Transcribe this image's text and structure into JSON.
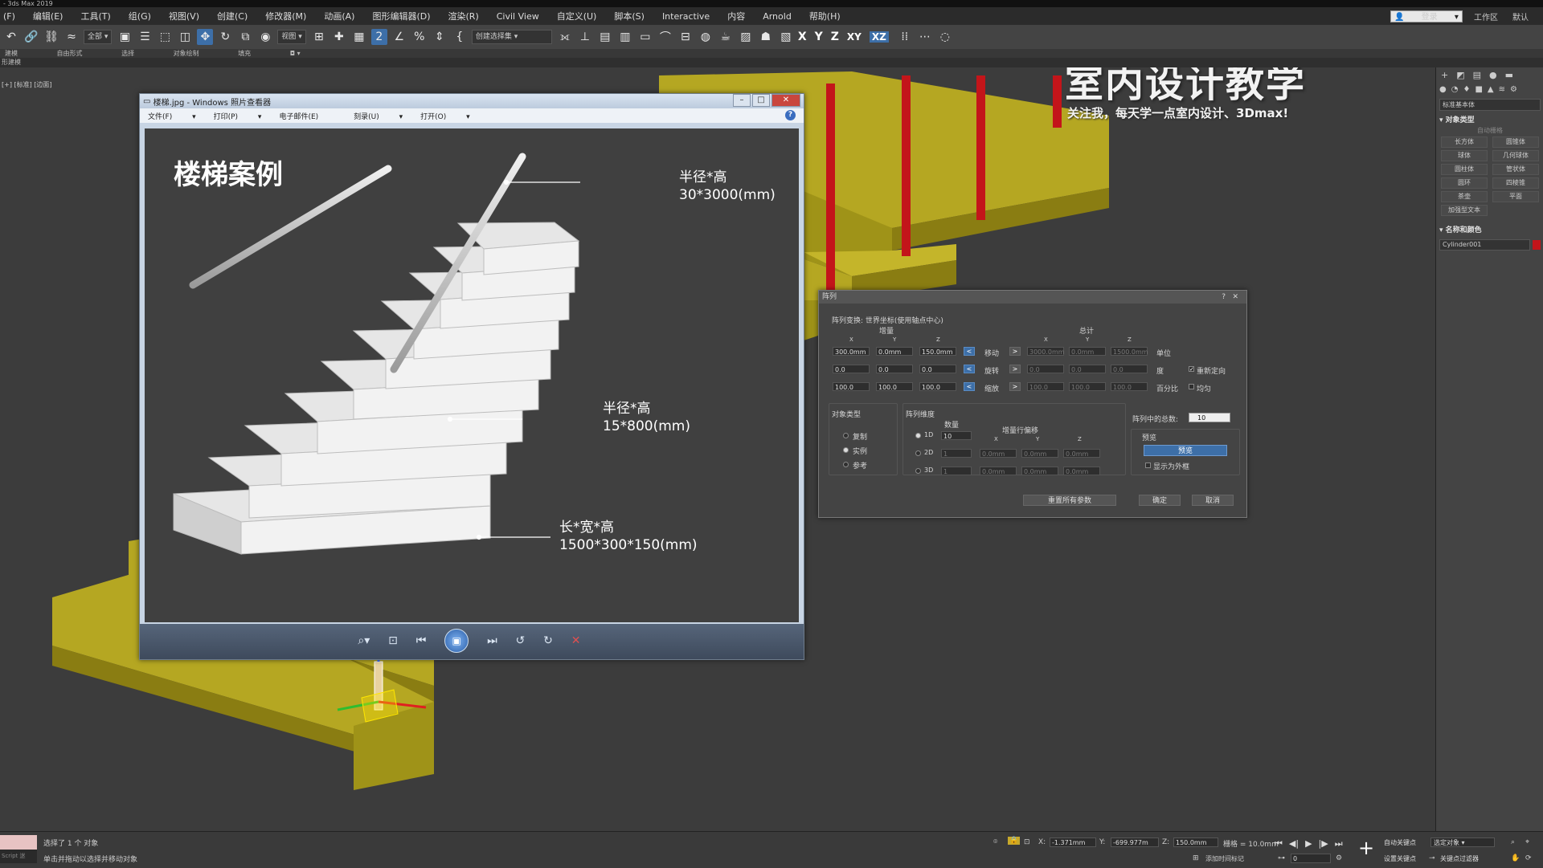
{
  "app": {
    "title": "- 3ds Max 2019"
  },
  "menu": {
    "items": [
      "(F)",
      "编辑(E)",
      "工具(T)",
      "组(G)",
      "视图(V)",
      "创建(C)",
      "修改器(M)",
      "动画(A)",
      "图形编辑器(D)",
      "渲染(R)",
      "Civil View",
      "自定义(U)",
      "脚本(S)",
      "Interactive",
      "内容",
      "Arnold",
      "帮助(H)"
    ],
    "login": "登录",
    "workspace_label": "工作区",
    "workspace_value": "默认"
  },
  "toolbar": {
    "filter_dropdown": "全部",
    "view_dropdown": "视图",
    "selection_set": "创建选择集",
    "axes": [
      "X",
      "Y",
      "Z",
      "XY",
      "XZ"
    ]
  },
  "ribbon": {
    "tabs": [
      "建模",
      "自由形式",
      "选择",
      "对象绘制",
      "填充"
    ],
    "subtab": "形建模"
  },
  "viewport": {
    "label": "[+] [标准] [边面]",
    "watermark_title": "室内设计教学",
    "watermark_sub": "关注我，每天学一点室内设计、3Dmax!",
    "colors": {
      "stair": "#b5a722",
      "stair_side": "#8a7d12",
      "rail": "#c3151a",
      "background": "#3c3c3c"
    }
  },
  "photo_viewer": {
    "title": "楼梯.jpg - Windows 照片查看器",
    "menu": [
      "文件(F)",
      "打印(P)",
      "电子邮件(E)",
      "刻录(U)",
      "打开(O)"
    ],
    "image": {
      "title": "楼梯案例",
      "annotations": [
        {
          "line1": "半径*高",
          "line2": "30*3000(mm)"
        },
        {
          "line1": "半径*高",
          "line2": "15*800(mm)"
        },
        {
          "line1": "长*宽*高",
          "line2": "1500*300*150(mm)"
        }
      ]
    }
  },
  "array_dialog": {
    "title": "阵列",
    "transform_label": "阵列变换:  世界坐标(使用轴点中心)",
    "increment_label": "增量",
    "total_label": "总计",
    "axis_x": "X",
    "axis_y": "Y",
    "axis_z": "Z",
    "rows": [
      {
        "label": "移动",
        "inc": [
          "300.0mm",
          "0.0mm",
          "150.0mm"
        ],
        "total": [
          "3000.0mm",
          "0.0mm",
          "1500.0mm"
        ],
        "unit": "单位"
      },
      {
        "label": "旋转",
        "inc": [
          "0.0",
          "0.0",
          "0.0"
        ],
        "total": [
          "0.0",
          "0.0",
          "0.0"
        ],
        "unit": "度"
      },
      {
        "label": "缩放",
        "inc": [
          "100.0",
          "100.0",
          "100.0"
        ],
        "total": [
          "100.0",
          "100.0",
          "100.0"
        ],
        "unit": "百分比"
      }
    ],
    "reorient": "重新定向",
    "uniform": "均匀",
    "object_type": {
      "title": "对象类型",
      "options": [
        "复制",
        "实例",
        "参考"
      ],
      "selected": 1
    },
    "dimensions": {
      "title": "阵列维度",
      "count_label": "数量",
      "offset_label": "增量行偏移",
      "rows": [
        {
          "label": "1D",
          "count": "10"
        },
        {
          "label": "2D",
          "count": "1",
          "offsets": [
            "0.0mm",
            "0.0mm",
            "0.0mm"
          ]
        },
        {
          "label": "3D",
          "count": "1",
          "offsets": [
            "0.0mm",
            "0.0mm",
            "0.0mm"
          ]
        }
      ]
    },
    "total_in_array_label": "阵列中的总数:",
    "total_in_array": "10",
    "preview_label": "预览",
    "preview_button": "预览",
    "show_as_box": "显示为外框",
    "reset_button": "重置所有参数",
    "ok_button": "确定",
    "cancel_button": "取消"
  },
  "command_panel": {
    "dropdown": "标准基本体",
    "section_object_type": "对象类型",
    "autogrid": "自动栅格",
    "buttons": [
      "长方体",
      "圆锥体",
      "球体",
      "几何球体",
      "圆柱体",
      "管状体",
      "圆环",
      "四棱锥",
      "茶壶",
      "平面",
      "加强型文本"
    ],
    "section_name_color": "名称和颜色",
    "object_name": "Cylinder001"
  },
  "status_bar": {
    "maxscript": "Script 迷",
    "selected": "选择了 1 个 对象",
    "hint": "单击并拖动以选择并移动对象",
    "x_label": "X:",
    "x_value": "-1.371mm",
    "y_label": "Y:",
    "y_value": "-699.977m",
    "z_label": "Z:",
    "z_value": "150.0mm",
    "grid_label": "栅格 = 10.0mm",
    "add_time_tag": "添加时间标记",
    "autokey": "自动关键点",
    "selected_objects": "选定对象",
    "set_key": "设置关键点",
    "key_filters": "关键点过滤器",
    "frame": "0"
  }
}
